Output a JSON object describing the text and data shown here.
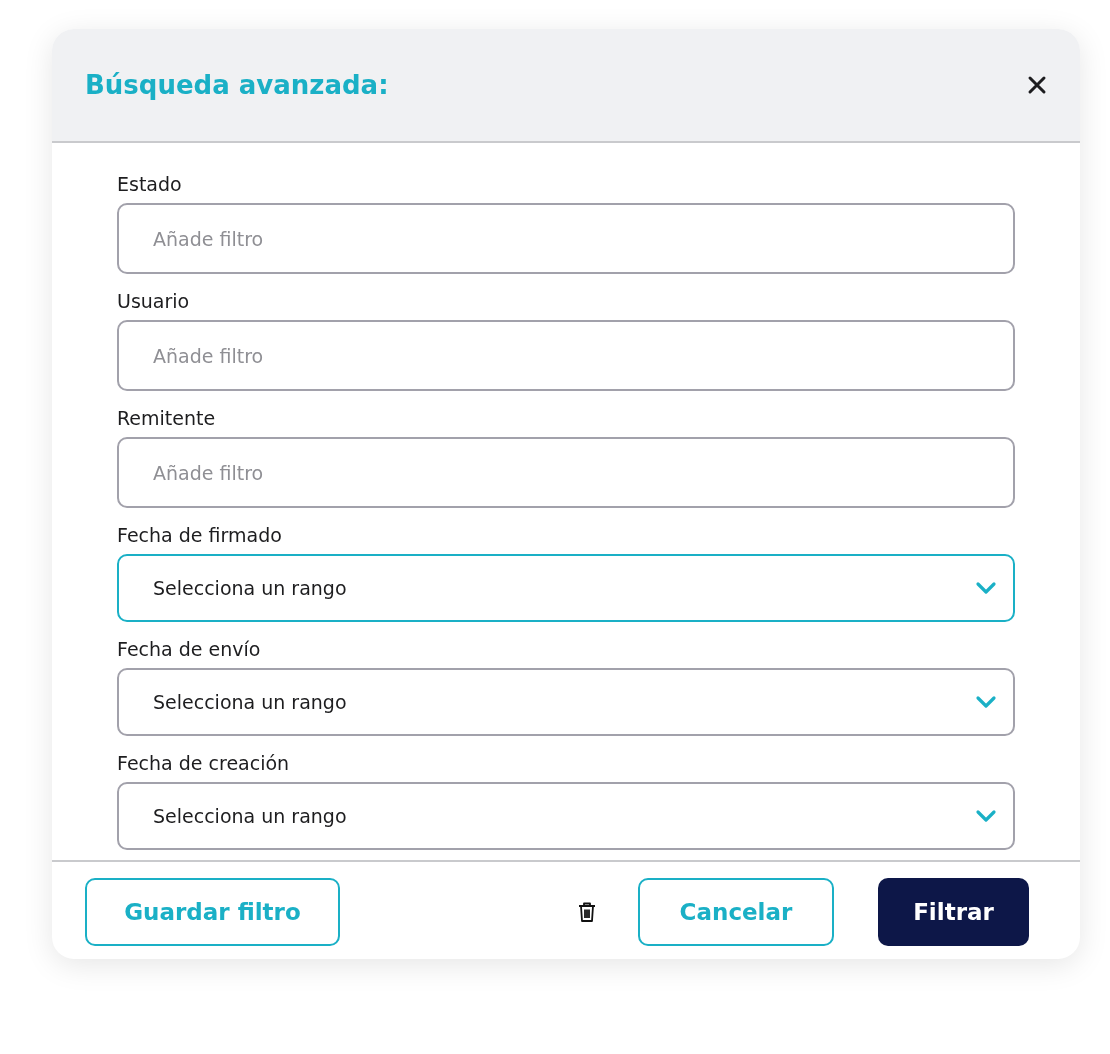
{
  "dialog": {
    "title": "Búsqueda avanzada:"
  },
  "fields": [
    {
      "kind": "text",
      "label": "Estado",
      "placeholder": "Añade filtro",
      "focused": false
    },
    {
      "kind": "text",
      "label": "Usuario",
      "placeholder": "Añade filtro",
      "focused": false
    },
    {
      "kind": "text",
      "label": "Remitente",
      "placeholder": "Añade filtro",
      "focused": false
    },
    {
      "kind": "select",
      "label": "Fecha de firmado",
      "value": "Selecciona un rango",
      "focused": true
    },
    {
      "kind": "select",
      "label": "Fecha de envío",
      "value": "Selecciona un rango",
      "focused": false
    },
    {
      "kind": "select",
      "label": "Fecha de creación",
      "value": "Selecciona un rango",
      "focused": false
    }
  ],
  "footer": {
    "save_button": "Guardar filtro",
    "cancel_button": "Cancelar",
    "filter_button": "Filtrar"
  }
}
